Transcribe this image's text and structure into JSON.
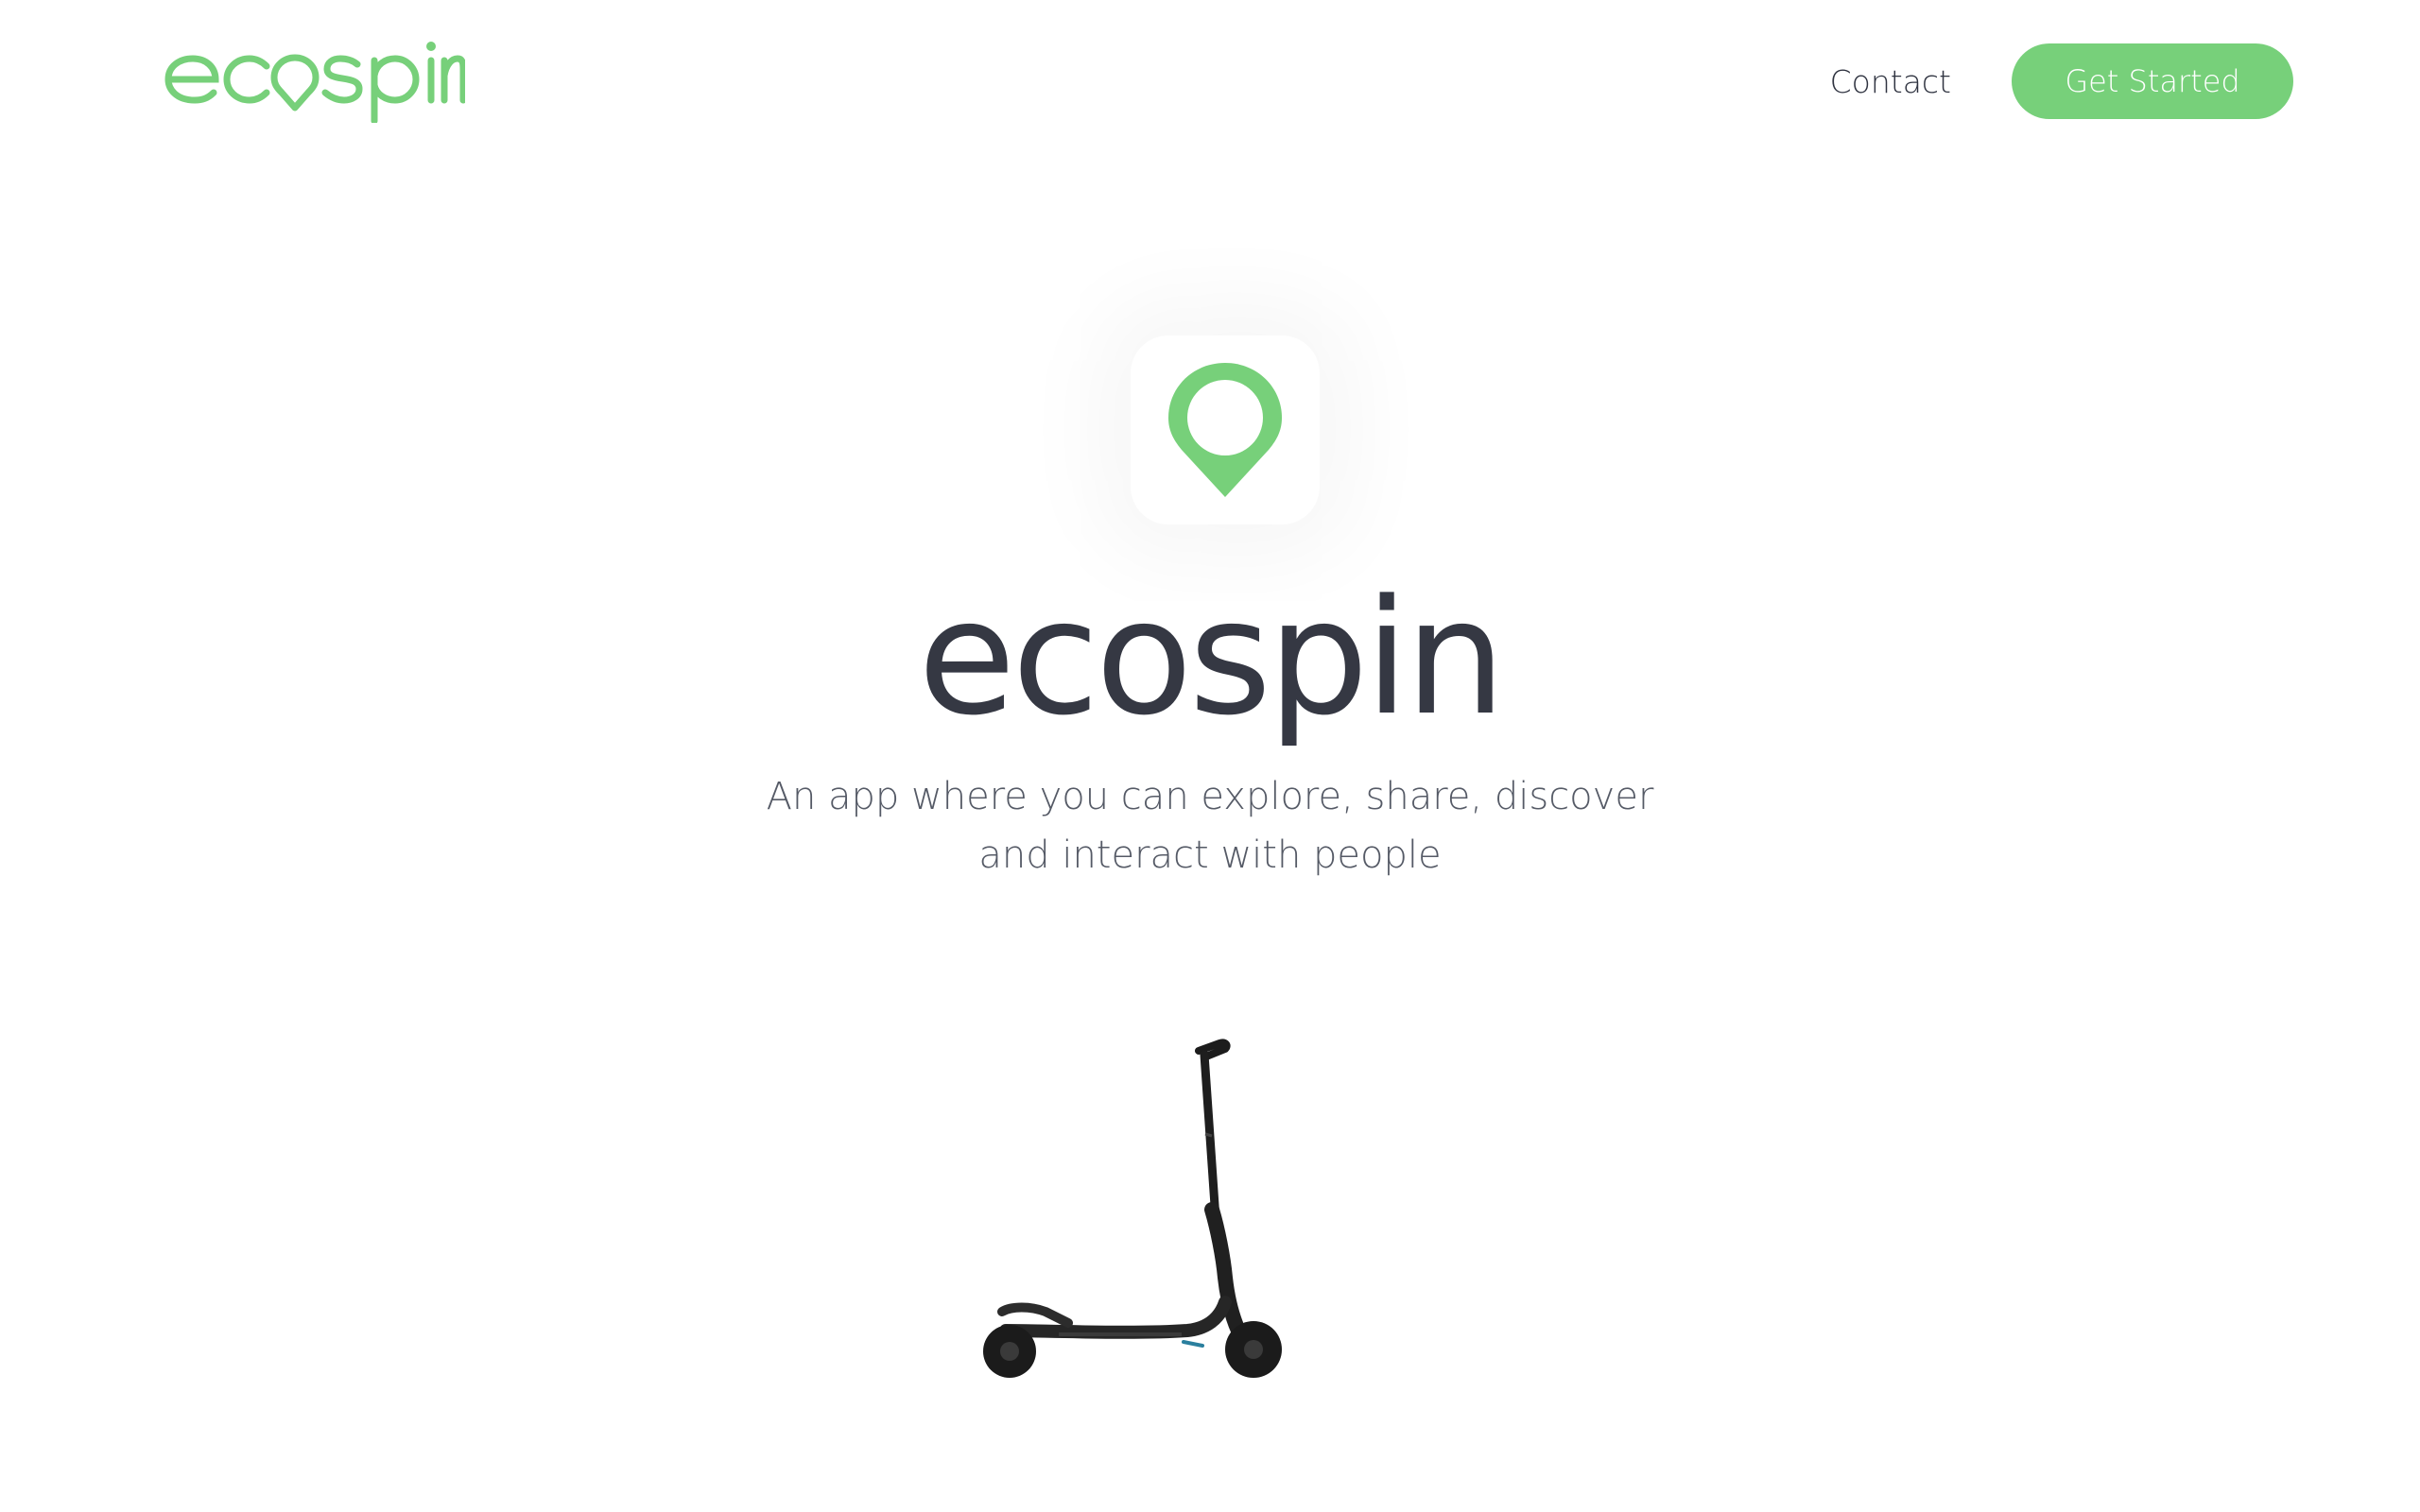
{
  "header": {
    "logo_text": "ecospin",
    "nav": {
      "contact_label": "Contact",
      "cta_label": "Get Started"
    }
  },
  "hero": {
    "icon": "map-pin-icon",
    "title": "ecospin",
    "tagline": "An app where you can explore, share, discover and interact with people",
    "image": "electric-scooter"
  },
  "colors": {
    "accent": "#77d07a",
    "title": "#353843",
    "text": "#555a66",
    "background": "#ffffff"
  }
}
